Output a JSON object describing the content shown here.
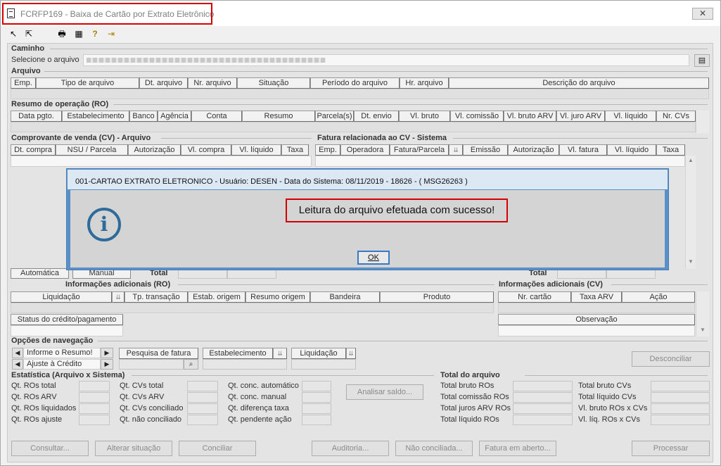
{
  "window": {
    "title": "FCRFP169 - Baixa de Cartão por Extrato Eletrônico",
    "close_label": "✕"
  },
  "toolbar": {
    "icons": [
      "↖",
      "⇱",
      "🖶",
      "▦",
      "?",
      "⇥"
    ]
  },
  "caminho": {
    "section_title": "Caminho",
    "select_label": "Selecione o arquivo"
  },
  "arquivo": {
    "section_title": "Arquivo",
    "columns": [
      "Emp.",
      "Tipo de arquivo",
      "Dt. arquivo",
      "Nr. arquivo",
      "Situação",
      "Período do arquivo",
      "Hr. arquivo",
      "Descrição do arquivo"
    ]
  },
  "resumo": {
    "section_title": "Resumo de operação (RO)",
    "columns": [
      "Data pgto.",
      "Estabelecimento",
      "Banco",
      "Agência",
      "Conta",
      "Resumo",
      "Parcela(s)",
      "Dt. envio",
      "Vl. bruto",
      "Vl. comissão",
      "Vl. bruto ARV",
      "Vl. juro ARV",
      "Vl. líquido",
      "Nr. CVs"
    ]
  },
  "comprovante": {
    "section_title": "Comprovante de venda (CV) - Arquivo",
    "columns": [
      "Dt. compra",
      "NSU / Parcela",
      "Autorização",
      "Vl. compra",
      "Vl. líquido",
      "Taxa"
    ],
    "tab_auto": "Automática",
    "tab_manual": "Manual",
    "total_label": "Total"
  },
  "fatura": {
    "section_title": "Fatura relacionada ao CV - Sistema",
    "columns": [
      "Emp.",
      "Operadora",
      "Fatura/Parcela",
      "",
      "Emissão",
      "Autorização",
      "Vl. fatura",
      "Vl. líquido",
      "Taxa"
    ],
    "total_label": "Total"
  },
  "info_ro": {
    "section_title": "Informações adicionais (RO)",
    "columns": [
      "Liquidação",
      "",
      "Tp. transação",
      "Estab. origem",
      "Resumo origem",
      "Bandeira",
      "Produto"
    ],
    "status_label": "Status do crédito/pagamento"
  },
  "info_cv": {
    "section_title": "Informações adicionais (CV)",
    "columns": [
      "Nr. cartão",
      "Taxa ARV",
      "Ação"
    ],
    "obs_label": "Observação"
  },
  "navegacao": {
    "section_title": "Opções de navegação",
    "nav1": "Informe o Resumo!",
    "nav2": "Ajuste à Crédito",
    "pesquisa": "Pesquisa de fatura",
    "estabelecimento": "Estabelecimento",
    "liquidacao": "Liquidação",
    "desconciliar": "Desconciliar"
  },
  "estatistica": {
    "section_title": "Estatística (Arquivo x Sistema)",
    "col1": [
      "Qt. ROs total",
      "Qt. ROs ARV",
      "Qt. ROs liquidados",
      "Qt. ROs ajuste"
    ],
    "col2": [
      "Qt. CVs total",
      "Qt. CVs ARV",
      "Qt. CVs conciliado",
      "Qt. não conciliado"
    ],
    "col3": [
      "Qt. conc. automático",
      "Qt. conc. manual",
      "Qt. diferença taxa",
      "Qt. pendente ação"
    ],
    "analisar": "Analisar saldo..."
  },
  "total_arquivo": {
    "section_title": "Total do arquivo",
    "col1": [
      "Total bruto ROs",
      "Total comissão ROs",
      "Total juros ARV ROs",
      "Total líquido ROs"
    ],
    "col2": [
      "Total bruto CVs",
      "Total líquido CVs",
      "Vl. bruto ROs x CVs",
      "Vl. líq. ROs x CVs"
    ]
  },
  "footer": {
    "consultar": "Consultar...",
    "alterar": "Alterar situação",
    "conciliar": "Conciliar",
    "auditoria": "Auditoria...",
    "nao_conciliada": "Não conciliada...",
    "fatura_aberto": "Fatura em aberto...",
    "processar": "Processar"
  },
  "dialog": {
    "title": "001-CARTAO EXTRATO ELETRONICO - Usuário: DESEN - Data do Sistema: 08/11/2019 - 18626 - ( MSG26263 )",
    "message": "Leitura do arquivo efetuada com sucesso!",
    "ok": "OK"
  }
}
